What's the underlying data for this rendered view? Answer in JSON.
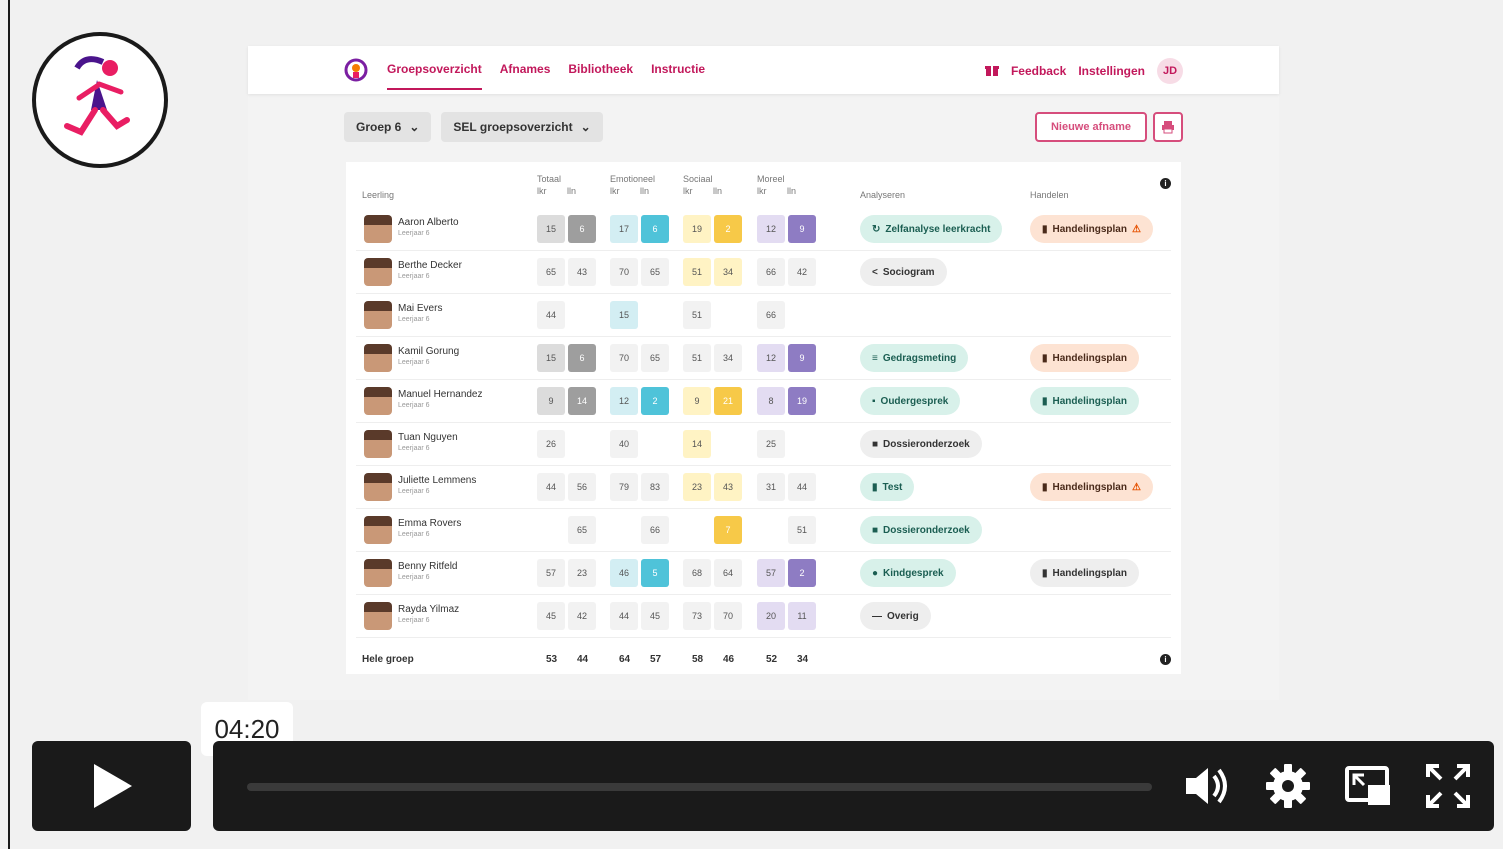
{
  "app": {
    "nav": [
      "Groepsoverzicht",
      "Afnames",
      "Bibliotheek",
      "Instructie"
    ],
    "feedback": "Feedback",
    "settings": "Instellingen",
    "user_initials": "JD",
    "group_select": "Groep 6",
    "view_select": "SEL groepsoverzicht",
    "new_button": "Nieuwe afname"
  },
  "table": {
    "col_student": "Leerling",
    "groups": [
      "Totaal",
      "Emotioneel",
      "Sociaal",
      "Moreel"
    ],
    "sub_lkr": "lkr",
    "sub_lln": "lln",
    "col_analyse": "Analyseren",
    "col_handelen": "Handelen",
    "rows": [
      {
        "name": "Aaron Alberto",
        "sub": "Leerjaar 6",
        "t": [
          "15",
          "6"
        ],
        "e": [
          "17",
          "6"
        ],
        "s": [
          "19",
          "2"
        ],
        "m": [
          "12",
          "9"
        ],
        "analyse": "Zelfanalyse leerkracht",
        "handelen": "Handelingsplan"
      },
      {
        "name": "Berthe Decker",
        "sub": "Leerjaar 6",
        "t": [
          "65",
          "43"
        ],
        "e": [
          "70",
          "65"
        ],
        "s": [
          "51",
          "34"
        ],
        "m": [
          "66",
          "42"
        ],
        "analyse": "Sociogram",
        "handelen": ""
      },
      {
        "name": "Mai Evers",
        "sub": "Leerjaar 6",
        "t": [
          "44",
          ""
        ],
        "e": [
          "15",
          ""
        ],
        "s": [
          "51",
          ""
        ],
        "m": [
          "66",
          ""
        ],
        "analyse": "",
        "handelen": ""
      },
      {
        "name": "Kamil Gorung",
        "sub": "Leerjaar 6",
        "t": [
          "15",
          "6"
        ],
        "e": [
          "70",
          "65"
        ],
        "s": [
          "51",
          "34"
        ],
        "m": [
          "12",
          "9"
        ],
        "analyse": "Gedragsmeting",
        "handelen": "Handelingsplan"
      },
      {
        "name": "Manuel Hernandez",
        "sub": "Leerjaar 6",
        "t": [
          "9",
          "14"
        ],
        "e": [
          "12",
          "2"
        ],
        "s": [
          "9",
          "21"
        ],
        "m": [
          "8",
          "19"
        ],
        "analyse": "Oudergesprek",
        "handelen": "Handelingsplan"
      },
      {
        "name": "Tuan Nguyen",
        "sub": "Leerjaar 6",
        "t": [
          "26",
          ""
        ],
        "e": [
          "40",
          ""
        ],
        "s": [
          "14",
          ""
        ],
        "m": [
          "25",
          ""
        ],
        "analyse": "Dossieronderzoek",
        "handelen": ""
      },
      {
        "name": "Juliette Lemmens",
        "sub": "Leerjaar 6",
        "t": [
          "44",
          "56"
        ],
        "e": [
          "79",
          "83"
        ],
        "s": [
          "23",
          "43"
        ],
        "m": [
          "31",
          "44"
        ],
        "analyse": "Test",
        "handelen": "Handelingsplan"
      },
      {
        "name": "Emma Rovers",
        "sub": "Leerjaar 6",
        "t": [
          "",
          "65"
        ],
        "e": [
          "",
          "66"
        ],
        "s": [
          "",
          "7"
        ],
        "m": [
          "",
          "51"
        ],
        "analyse": "Dossieronderzoek",
        "handelen": ""
      },
      {
        "name": "Benny Ritfeld",
        "sub": "Leerjaar 6",
        "t": [
          "57",
          "23"
        ],
        "e": [
          "46",
          "5"
        ],
        "s": [
          "68",
          "64"
        ],
        "m": [
          "57",
          "2"
        ],
        "analyse": "Kindgesprek",
        "handelen": "Handelingsplan"
      },
      {
        "name": "Rayda Yilmaz",
        "sub": "Leerjaar 6",
        "t": [
          "45",
          "42"
        ],
        "e": [
          "44",
          "45"
        ],
        "s": [
          "73",
          "70"
        ],
        "m": [
          "20",
          "11"
        ],
        "analyse": "Overig",
        "handelen": ""
      }
    ],
    "footer_label": "Hele groep",
    "footer_values": [
      "53",
      "44",
      "64",
      "57",
      "58",
      "46",
      "52",
      "34"
    ]
  },
  "video": {
    "timestamp": "04:20"
  },
  "colors": {
    "brand": "#c2185b",
    "gray_strong": "#9e9e9e",
    "teal_light": "#d3eef3",
    "teal_strong": "#4fc3d9",
    "yellow_light": "#fff3c4",
    "yellow_strong": "#f7c948",
    "purple_light": "#e3dcf2",
    "purple_strong": "#8e7cc3"
  }
}
